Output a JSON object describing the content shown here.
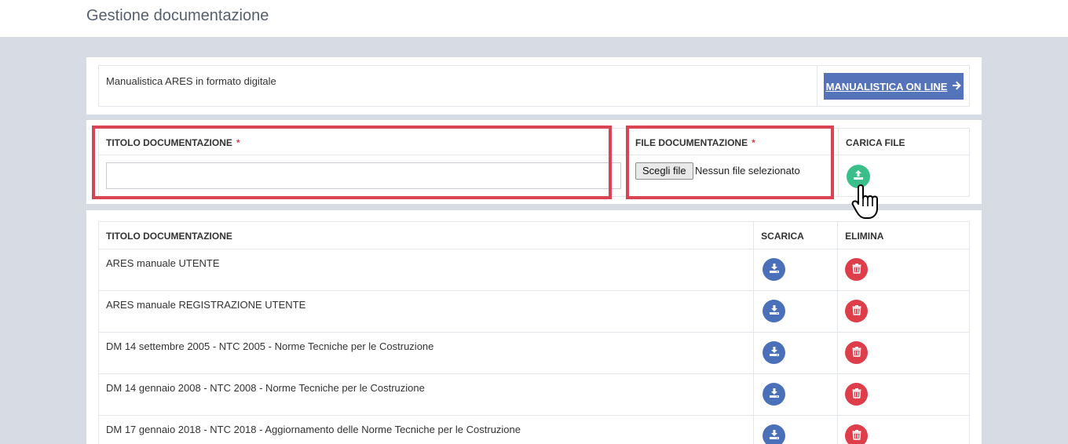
{
  "header": {
    "title": "Gestione documentazione"
  },
  "manual": {
    "text": "Manualistica ARES in formato digitale",
    "button_label": "MANUALISTICA ON LINE",
    "button_icon": "arrow-right-icon"
  },
  "upload": {
    "title_label": "TITOLO DOCUMENTAZIONE",
    "file_label": "FILE DOCUMENTAZIONE",
    "required_mark": "*",
    "title_value": "",
    "file_button_label": "Scegli file",
    "file_status": "Nessun file selezionato",
    "upload_label": "CARICA FILE",
    "upload_icon": "upload-icon"
  },
  "table": {
    "headers": {
      "title": "TITOLO DOCUMENTAZIONE",
      "download": "SCARICA",
      "delete": "ELIMINA"
    },
    "rows": [
      {
        "title": "ARES manuale UTENTE"
      },
      {
        "title": "ARES manuale REGISTRAZIONE UTENTE"
      },
      {
        "title": "DM 14 settembre 2005 - NTC 2005 - Norme Tecniche per le Costruzione"
      },
      {
        "title": "DM 14 gennaio 2008 - NTC 2008 - Norme Tecniche per le Costruzione"
      },
      {
        "title": "DM 17 gennaio 2018 - NTC 2018 - Aggiornamento delle Norme Tecniche per le Costruzione"
      }
    ]
  },
  "colors": {
    "primary": "#5473b8",
    "success": "#3bbf8a",
    "danger": "#de3d4a",
    "highlight": "#d94452",
    "background": "#d6dbe4"
  }
}
